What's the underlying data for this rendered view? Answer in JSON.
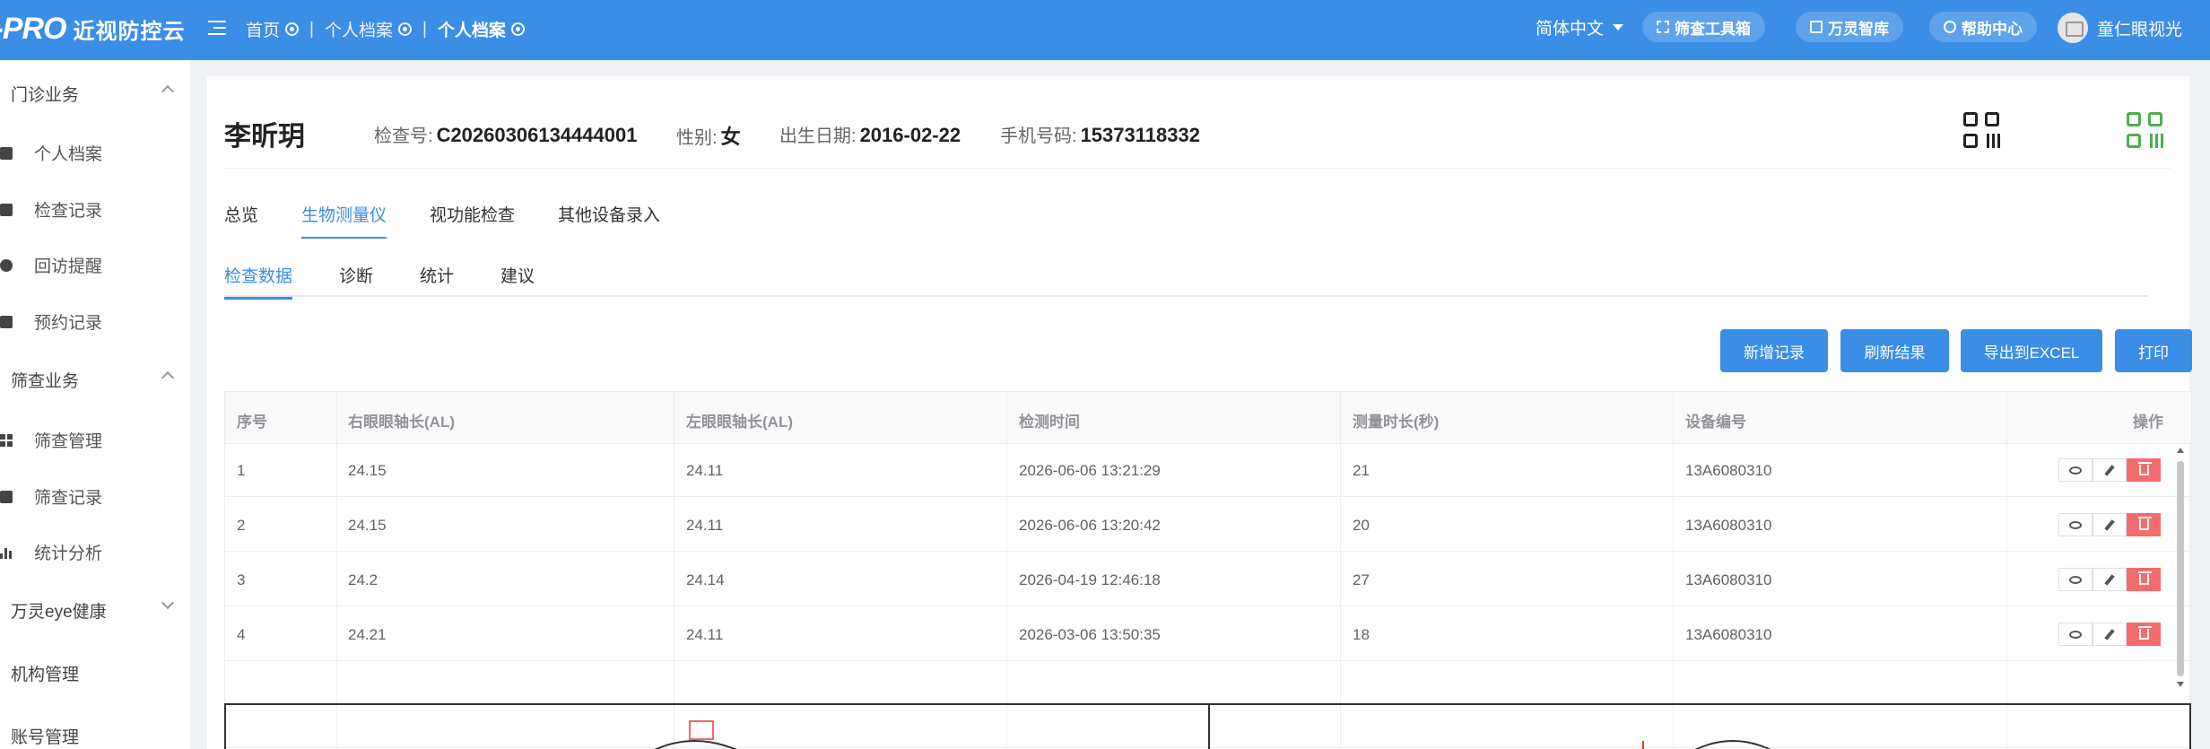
{
  "topbar": {
    "logo_text": "I-PRO",
    "logo_sub": "近视防控云",
    "breadcrumbs": [
      {
        "label": "首页"
      },
      {
        "label": "个人档案"
      },
      {
        "label": "个人档案"
      }
    ],
    "language": "简体中文",
    "pills": [
      {
        "label": "筛查工具箱",
        "icon": "scan-icon"
      },
      {
        "label": "万灵智库",
        "icon": "book-icon"
      },
      {
        "label": "帮助中心",
        "icon": "help-icon"
      }
    ],
    "user_name": "童仁眼视光"
  },
  "sidebar": {
    "group1": "门诊业务",
    "group1_items": [
      "个人档案",
      "检查记录",
      "回访提醒",
      "预约记录"
    ],
    "group2": "筛查业务",
    "group2_items": [
      "筛查管理",
      "筛查记录",
      "统计分析"
    ],
    "group3": "万灵eye健康",
    "plain_items": [
      "机构管理",
      "账号管理"
    ]
  },
  "patient": {
    "name": "李昕玥",
    "exam_no_label": "检查号:",
    "exam_no": "C20260306134444001",
    "gender_label": "性别:",
    "gender": "女",
    "dob_label": "出生日期:",
    "dob": "2016-02-22",
    "phone_label": "手机号码:",
    "phone": "15373118332"
  },
  "tabs": [
    "总览",
    "生物测量仪",
    "视功能检查",
    "其他设备录入"
  ],
  "active_tab": 1,
  "subtabs": [
    "检查数据",
    "诊断",
    "统计",
    "建议"
  ],
  "active_subtab": 0,
  "actions": {
    "add": "新增记录",
    "refresh": "刷新结果",
    "export": "导出到EXCEL",
    "print": "打印"
  },
  "table": {
    "headers": [
      "序号",
      "右眼眼轴长(AL)",
      "左眼眼轴长(AL)",
      "检测时间",
      "测量时长(秒)",
      "设备编号",
      "操作"
    ],
    "rows": [
      [
        "1",
        "24.15",
        "24.11",
        "2026-06-06 13:21:29",
        "21",
        "13A6080310"
      ],
      [
        "2",
        "24.15",
        "24.11",
        "2026-06-06 13:20:42",
        "20",
        "13A6080310"
      ],
      [
        "3",
        "24.2",
        "24.14",
        "2026-04-19 12:46:18",
        "27",
        "13A6080310"
      ],
      [
        "4",
        "24.21",
        "24.11",
        "2026-03-06 13:50:35",
        "18",
        "13A6080310"
      ]
    ]
  },
  "colors": {
    "primary": "#3a8ee6",
    "danger": "#f56c6c",
    "qr_green": "#4caf50"
  }
}
